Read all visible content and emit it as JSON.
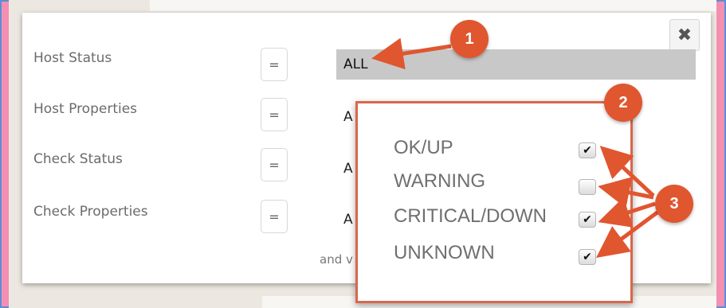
{
  "filters": [
    {
      "label": "Host Status",
      "operator": "=",
      "value": "ALL"
    },
    {
      "label": "Host Properties",
      "operator": "=",
      "value": "A"
    },
    {
      "label": "Check Status",
      "operator": "=",
      "value": "A"
    },
    {
      "label": "Check Properties",
      "operator": "=",
      "value": "A"
    }
  ],
  "footer_text": "and v",
  "close_label": "✖",
  "dropdown": {
    "options": [
      {
        "label": "OK/UP",
        "checked": "✔"
      },
      {
        "label": "WARNING",
        "checked": ""
      },
      {
        "label": "CRITICAL/DOWN",
        "checked": "✔"
      },
      {
        "label": "UNKNOWN",
        "checked": "✔"
      }
    ]
  },
  "annotations": {
    "one": "1",
    "two": "2",
    "three": "3",
    "color": "#e0562f"
  }
}
